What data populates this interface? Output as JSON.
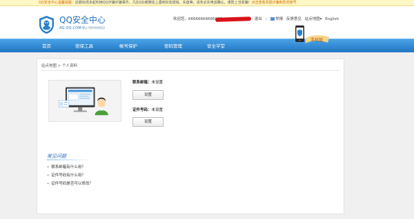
{
  "notice": {
    "label": "QQ安全中心温馨提醒：",
    "text": "近期出现多起利用QQ诈骗诈骗事件，凡在QQ或微信上遇到好友借钱、充值等，请务必先电话确认，谨防上当受骗！",
    "link": "点击查看举报诈骗和防范账号"
  },
  "logo": {
    "title": "QQ安全中心",
    "url": "AQ.QQ.COM",
    "slogan": "用心守护你的QQ"
  },
  "userbar": {
    "welcome": "欢迎您，66666666666666",
    "logout": "退出",
    "report": "举报",
    "feedback": "反馈意见",
    "sitemap": "站点地图",
    "language": "English"
  },
  "promo": {
    "label": "手机版"
  },
  "nav": {
    "items": [
      "首页",
      "密保工具",
      "帐号保护",
      "密码管理",
      "安全学堂"
    ]
  },
  "breadcrumb": {
    "root": "站点地图",
    "separator": ">",
    "current": "个人资料"
  },
  "fields": {
    "email": {
      "label": "联系邮箱：",
      "value": "未设置",
      "button": "设置"
    },
    "id": {
      "label": "证件号码：",
      "value": "未设置",
      "button": "设置"
    }
  },
  "faq": {
    "title": "常见问题",
    "items": [
      "联系邮箱有什么用？",
      "证件号码有什么用？",
      "证件号码是否可以修改？"
    ]
  },
  "colors": {
    "nav_blue": "#2176c2",
    "accent_blue": "#1f6fb5",
    "scribble_red": "#d9141a",
    "notice_bg": "#fff8c4"
  }
}
